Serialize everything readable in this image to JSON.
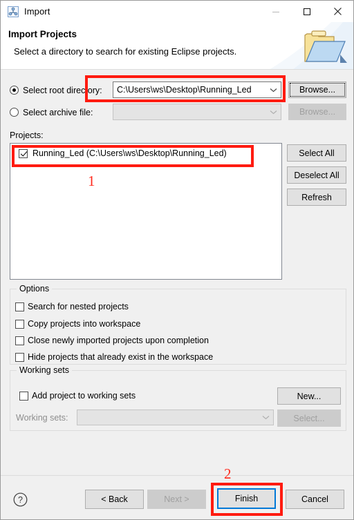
{
  "window": {
    "title": "Import",
    "icon": "import-wizard-icon",
    "controls": {
      "minimize": "minimize-icon",
      "maximize": "maximize-icon",
      "close": "close-icon"
    }
  },
  "header": {
    "title": "Import Projects",
    "description": "Select a directory to search for existing Eclipse projects.",
    "banner_icon": "folder-import-icon"
  },
  "source": {
    "root_directory": {
      "radio_label_pre": "Select roo",
      "radio_label_mnemonic": "t",
      "radio_label_post": " directory:",
      "label_full": "Select root directory:",
      "selected": true,
      "value": "C:\\Users\\ws\\Desktop\\Running_Led",
      "placeholder": "",
      "browse_label": "Browse...",
      "browse_mnemonic": "r",
      "browse_enabled": true
    },
    "archive_file": {
      "label_full": "Select archive file:",
      "label_pre": "Select ",
      "label_mnemonic": "a",
      "label_post": "rchive file:",
      "selected": false,
      "value": "",
      "browse_label": "Browse...",
      "browse_mnemonic": "r",
      "browse_enabled": false
    }
  },
  "projects": {
    "label": "Projects:",
    "label_mnemonic": "P",
    "items": [
      {
        "name": "Running_Led (C:\\Users\\ws\\Desktop\\Running_Led)",
        "checked": true
      }
    ],
    "buttons": [
      {
        "label": "Select All",
        "mnemonic": "S",
        "enabled": true,
        "name": "select-all-button"
      },
      {
        "label": "Deselect All",
        "mnemonic": "D",
        "enabled": true,
        "name": "deselect-all-button"
      },
      {
        "label": "Refresh",
        "mnemonic": "f",
        "enabled": true,
        "name": "refresh-button"
      }
    ]
  },
  "options": {
    "title": "Options",
    "items": [
      {
        "label": "Search for nested projects",
        "checked": false,
        "name": "option-search-nested"
      },
      {
        "label": "Copy projects into workspace",
        "checked": false,
        "name": "option-copy-into-workspace"
      },
      {
        "label": "Close newly imported projects upon completion",
        "checked": false,
        "name": "option-close-imported"
      },
      {
        "label": "Hide projects that already exist in the workspace",
        "checked": false,
        "name": "option-hide-existing"
      }
    ]
  },
  "working_sets": {
    "title": "Working sets",
    "add_checkbox_label": "Add project to working sets",
    "add_checkbox_checked": false,
    "combo_label": "Working sets:",
    "combo_value": "",
    "combo_enabled": false,
    "new_button": "New...",
    "new_button_enabled": true,
    "select_button": "Select...",
    "select_button_enabled": false
  },
  "footer": {
    "help_icon": "help-question-icon",
    "buttons": [
      {
        "label": "< Back",
        "enabled": true,
        "default": false,
        "name": "back-button"
      },
      {
        "label": "Next >",
        "enabled": false,
        "default": false,
        "name": "next-button"
      },
      {
        "label": "Finish",
        "enabled": true,
        "default": true,
        "name": "finish-button"
      },
      {
        "label": "Cancel",
        "enabled": true,
        "default": false,
        "name": "cancel-button"
      }
    ]
  },
  "annotations": {
    "color": "#ff1b10",
    "step_one": "1",
    "step_two": "2"
  }
}
